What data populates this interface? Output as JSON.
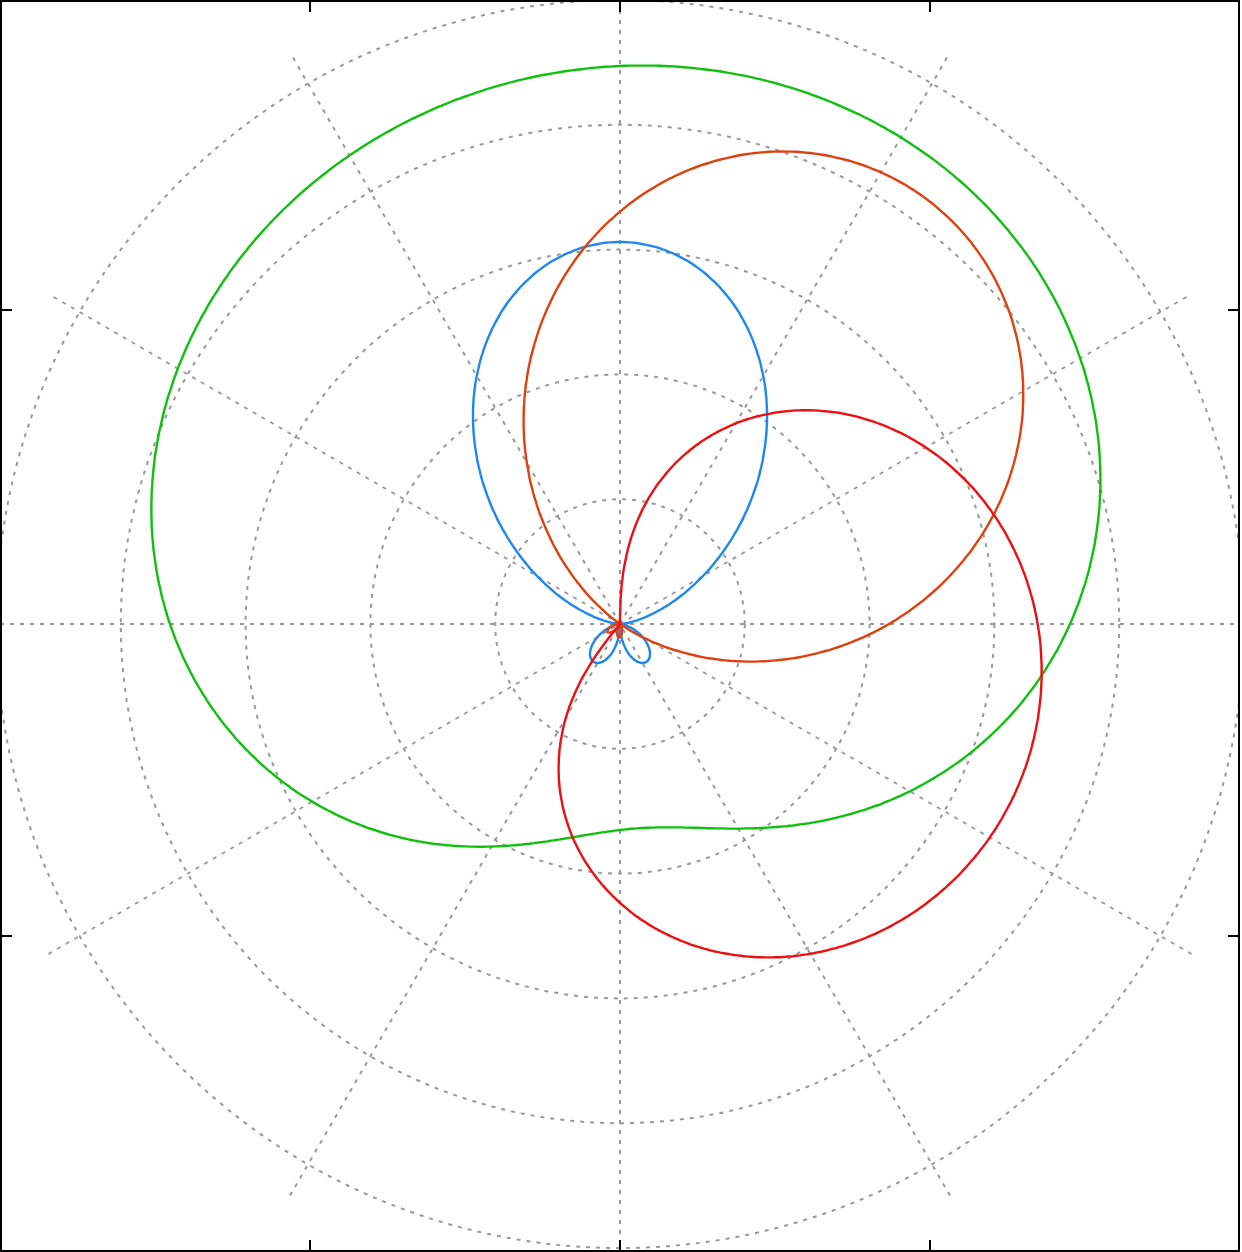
{
  "polar_plot": {
    "series": [
      {
        "color": "#10c010"
      },
      {
        "color": "#1e88ee"
      },
      {
        "color": "#e04010"
      },
      {
        "color": "#ee1010"
      }
    ]
  }
}
